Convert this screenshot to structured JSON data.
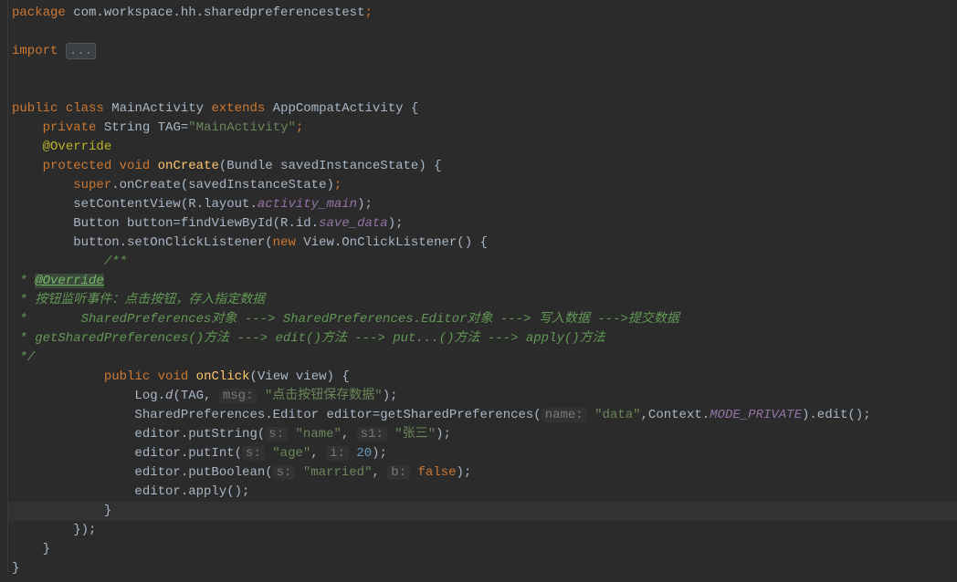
{
  "code": {
    "pkg_kw": "package",
    "pkg_name": " com.workspace.hh.sharedpreferencestest",
    "semicolon": ";",
    "import_kw": "import",
    "import_collapsed": "...",
    "public_kw": "public",
    "class_kw": "class",
    "class_name": " MainActivity ",
    "extends_kw": "extends",
    "super_class": " AppCompatActivity ",
    "brace_open": "{",
    "brace_close": "}",
    "private_kw": "private",
    "string_type": " String ",
    "tag_name": "TAG=",
    "tag_val": "\"MainActivity\"",
    "override": "@Override",
    "protected_kw": "protected",
    "void_kw": "void",
    "oncreate": "onCreate",
    "oncreate_params": "(Bundle savedInstanceState) ",
    "super_kw": "super",
    "oncreate_call": ".onCreate(savedInstanceState)",
    "setcontent": "setContentView(R.layout.",
    "activity_main": "activity_main",
    "paren_semi": ");",
    "button_decl": "Button button=findViewById(R.id.",
    "save_data": "save_data",
    "button_listener": "button.setOnClickListener(",
    "new_kw": "new",
    "view_listener": " View.OnClickListener() ",
    "doc_start": "/**",
    "doc_star": " * ",
    "override_hl": "@Override",
    "doc_line1": " * 按钮监听事件：点击按钮，存入指定数据",
    "doc_line2": " *       SharedPreferences对象 ---> SharedPreferences.Editor对象 ---> 写入数据 --->提交数据",
    "doc_line3": " * getSharedPreferences()方法 ---> edit()方法 ---> put...()方法 ---> apply()方法",
    "doc_end": " */",
    "onclick": "onClick",
    "onclick_params": "(View view) ",
    "log_prefix": "Log.",
    "log_d": "d",
    "log_args1": "(TAG, ",
    "msg_hint": "msg:",
    "log_msg": " \"点击按钮保存数据\"",
    "editor_decl": "SharedPreferences.Editor editor=getSharedPreferences(",
    "name_hint": "name:",
    "data_str": " \"data\"",
    "context_arg": ",Context.",
    "mode_private": "MODE_PRIVATE",
    "edit_call": ").edit();",
    "putstring": "editor.putString(",
    "s_hint": "s:",
    "name_str": " \"name\"",
    "comma_sp": ", ",
    "s1_hint": "s1:",
    "zhangsan": " \"张三\"",
    "putint": "editor.putInt(",
    "age_str": " \"age\"",
    "i_hint": "i:",
    "twenty": " 20",
    "putbool": "editor.putBoolean(",
    "married_str": " \"married\"",
    "b_hint": "b:",
    "false_kw": " false",
    "apply_call": "editor.apply();",
    "close_paren_semi": "});"
  }
}
